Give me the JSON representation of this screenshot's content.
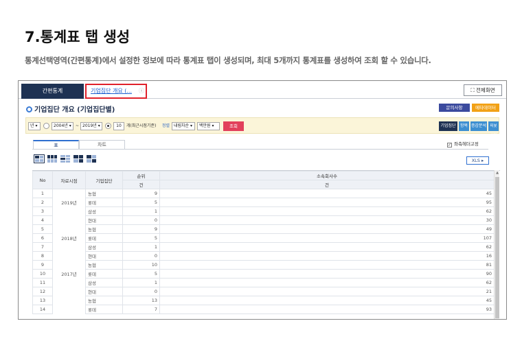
{
  "page": {
    "title": "7.통계표 탭 생성",
    "description": "통계선택영역(간편통계)에서 설정한 정보에 따라 통계표 탭이 생성되며, 최대 5개까지 통계표를 생성하여 조회 할 수 있습니다."
  },
  "app": {
    "tabs": {
      "simple_stats": "간편통계",
      "active_tab": "기업집단 개요 (...",
      "active_close": "ⓧ"
    },
    "fullscreen_button": "전체화면",
    "section_title": "기업집단 개요 (기업집단별)",
    "inquiry_button": "문의사항",
    "metadata_button": "메타데이터",
    "filter": {
      "period_unit": "년",
      "start_year": "2004년",
      "dash": "~",
      "end_year": "2019년",
      "count_value": "10",
      "count_suffix": "개(최근시점기준)",
      "sort_label": "정렬",
      "sort_select": "내림차순",
      "unit_select": "백만원",
      "search_button": "조회",
      "views": [
        "기업집단",
        "항목",
        "증감분석",
        "피봇설정"
      ]
    },
    "content_tabs": [
      "표",
      "차트"
    ],
    "left_header_fix": "좌측헤더고정",
    "xls_button": "XLS ▸",
    "table": {
      "headers": {
        "no": "No",
        "period": "자료시점",
        "group": "기업집단",
        "rank": "순위",
        "rank_unit": "건",
        "affiliates": "소속회사수",
        "affiliates_unit": "건"
      },
      "rows": [
        {
          "no": "1",
          "period": "",
          "group": "농협",
          "rank": "9",
          "count": "45"
        },
        {
          "no": "2",
          "period": "2019년",
          "group": "롯데",
          "rank": "5",
          "count": "95"
        },
        {
          "no": "3",
          "period": "",
          "group": "삼성",
          "rank": "1",
          "count": "62"
        },
        {
          "no": "4",
          "period": "",
          "group": "현대",
          "rank": "0",
          "count": "30"
        },
        {
          "no": "5",
          "period": "",
          "group": "농협",
          "rank": "9",
          "count": "49"
        },
        {
          "no": "6",
          "period": "2018년",
          "group": "롯데",
          "rank": "5",
          "count": "107"
        },
        {
          "no": "7",
          "period": "",
          "group": "삼성",
          "rank": "1",
          "count": "62"
        },
        {
          "no": "8",
          "period": "",
          "group": "현대",
          "rank": "0",
          "count": "16"
        },
        {
          "no": "9",
          "period": "",
          "group": "농협",
          "rank": "10",
          "count": "81"
        },
        {
          "no": "10",
          "period": "2017년",
          "group": "롯데",
          "rank": "5",
          "count": "90"
        },
        {
          "no": "11",
          "period": "",
          "group": "삼성",
          "rank": "1",
          "count": "62"
        },
        {
          "no": "12",
          "period": "",
          "group": "현대",
          "rank": "0",
          "count": "21"
        },
        {
          "no": "13",
          "period": "",
          "group": "농협",
          "rank": "13",
          "count": "45"
        },
        {
          "no": "14",
          "period": "",
          "group": "롯데",
          "rank": "7",
          "count": "93"
        }
      ]
    }
  },
  "colors": {
    "nav_dark": "#1e3253",
    "highlight_red": "#e0202a",
    "inquiry_blue": "#3b4a9e",
    "meta_orange": "#f2a115",
    "search_pink": "#e2405b",
    "filter_bg": "#fbf5d9"
  },
  "icons": [
    "fullscreen-icon",
    "radio-icon",
    "checkbox-icon",
    "layout-icon",
    "dropdown-icon",
    "scroll-up-icon"
  ]
}
